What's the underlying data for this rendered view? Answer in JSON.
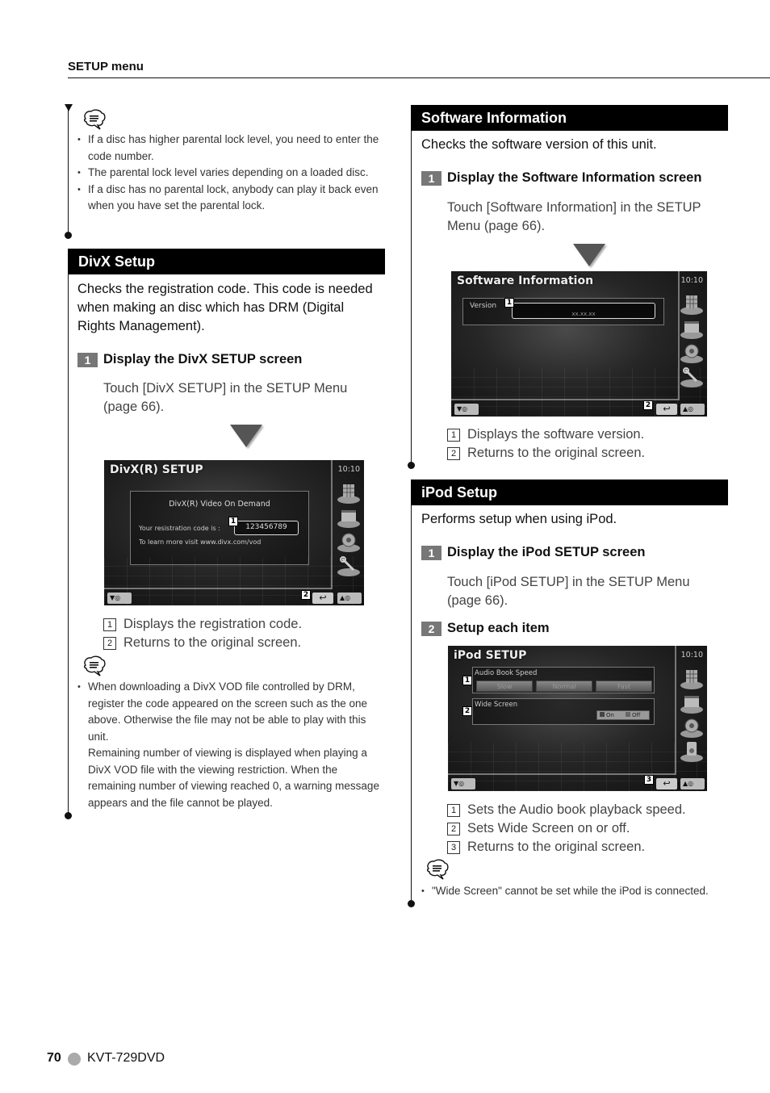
{
  "header": {
    "title": "SETUP menu"
  },
  "left": {
    "top_note": {
      "icon": "note-speech-bubble-icon",
      "bullets": [
        "If a disc has higher parental lock level, you need to enter the code number.",
        "The parental lock level varies depending on a loaded disc.",
        "If a disc has no parental lock, anybody can play it back even when you have set the parental lock."
      ]
    },
    "divx": {
      "title": "DivX Setup",
      "description": "Checks the registration code. This code is needed when making an disc which has DRM (Digital Rights Management).",
      "step1": {
        "num": "1",
        "title": "Display the DivX SETUP screen",
        "body": "Touch [DivX SETUP] in the SETUP Menu (page 66)."
      },
      "screen": {
        "title": "DivX(R) SETUP",
        "clock": "10:10",
        "panel_heading": "DivX(R) Video On Demand",
        "code_label": "Your resistration code is :",
        "code_value": "123456789",
        "learn_more": "To learn more visit www.divx.com/vod",
        "callout1": "1",
        "callout2": "2",
        "btn_down": "▼◎",
        "btn_up": "▲◎",
        "btn_return": "↩"
      },
      "legend": [
        {
          "key": "1",
          "text": "Displays the registration code."
        },
        {
          "key": "2",
          "text": "Returns to the original screen."
        }
      ],
      "note": {
        "icon": "note-speech-bubble-icon",
        "bullet_p1": "When downloading a DivX VOD file controlled by DRM, register the code appeared on the screen such as the one above. Otherwise the file may not be able to play with this unit.",
        "bullet_p2": "Remaining number of viewing is displayed when playing a DivX VOD file with the viewing restriction. When the remaining number of viewing  reached 0, a warning message appears and the file cannot be played."
      }
    }
  },
  "right": {
    "software": {
      "title": "Software Information",
      "description": "Checks the software version of this unit.",
      "step1": {
        "num": "1",
        "title": "Display the Software Information screen",
        "body": "Touch [Software Information] in the SETUP Menu (page 66)."
      },
      "screen": {
        "title": "Software Information",
        "clock": "10:10",
        "version_label": "Version",
        "version_value": "xx.xx.xx",
        "callout1": "1",
        "callout2": "2",
        "btn_down": "▼◎",
        "btn_up": "▲◎",
        "btn_return": "↩"
      },
      "legend": [
        {
          "key": "1",
          "text": "Displays the software version."
        },
        {
          "key": "2",
          "text": "Returns to the original screen."
        }
      ]
    },
    "ipod": {
      "title": "iPod Setup",
      "description": "Performs setup when using iPod.",
      "step1": {
        "num": "1",
        "title": "Display the iPod SETUP screen",
        "body": "Touch [iPod SETUP] in the SETUP Menu (page 66)."
      },
      "step2": {
        "num": "2",
        "title": "Setup each item"
      },
      "screen": {
        "title": "iPod SETUP",
        "clock": "10:10",
        "audio_book_label": "Audio Book Speed",
        "speed_options": [
          "Slow",
          "Normal",
          "Fast"
        ],
        "wide_screen_label": "Wide Screen",
        "on_label": "On",
        "off_label": "Off",
        "callout1": "1",
        "callout2": "2",
        "callout3": "3",
        "btn_down": "▼◎",
        "btn_up": "▲◎",
        "btn_return": "↩"
      },
      "legend": [
        {
          "key": "1",
          "text": "Sets the Audio book playback speed."
        },
        {
          "key": "2",
          "text": "Sets Wide Screen on or off."
        },
        {
          "key": "3",
          "text": "Returns to the original screen."
        }
      ],
      "note": {
        "icon": "note-speech-bubble-icon",
        "bullet": "\"Wide Screen\" cannot be set while the iPod is connected."
      }
    }
  },
  "footer": {
    "page": "70",
    "model": "KVT-729DVD"
  }
}
